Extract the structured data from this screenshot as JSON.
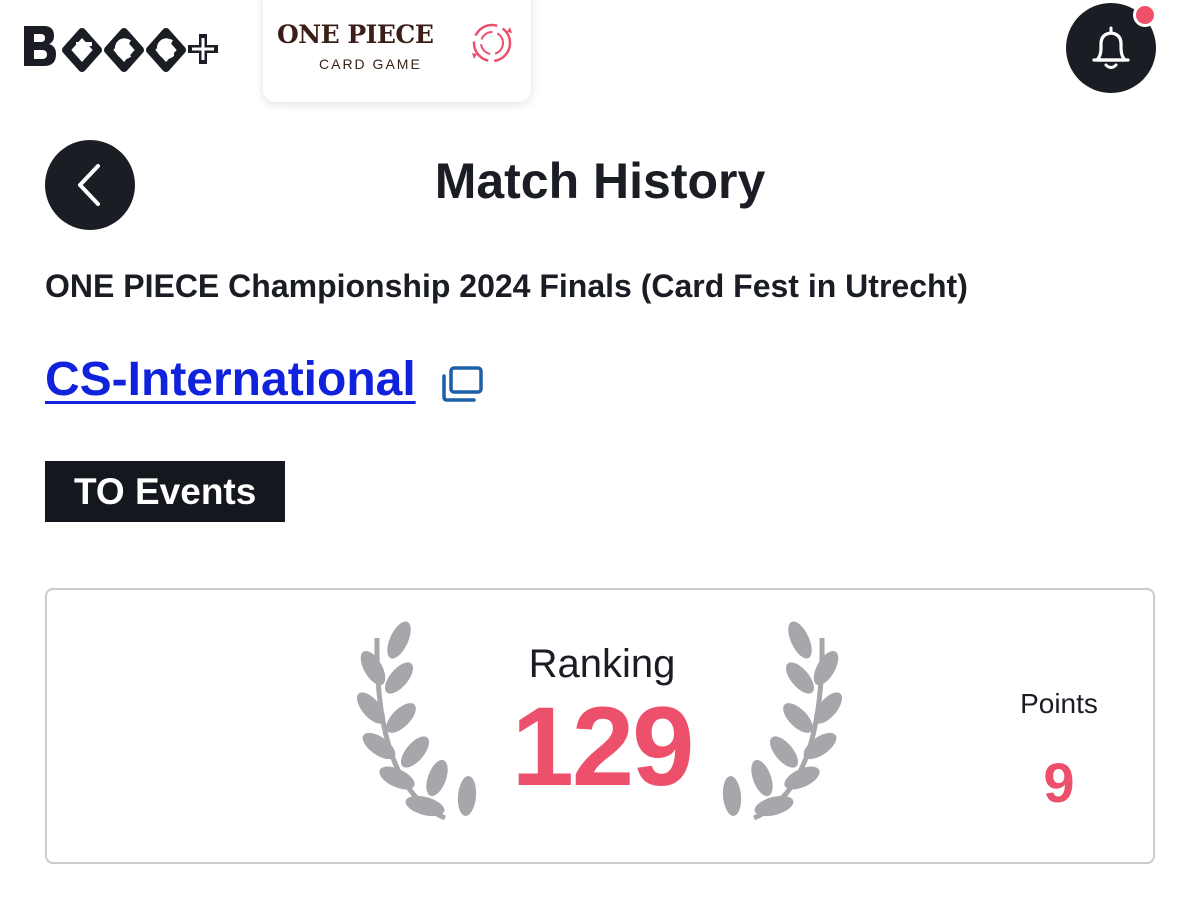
{
  "header": {
    "brand_logo_text": "B TCG +",
    "game_logo": {
      "title": "ONE PIECE",
      "subtitle": "CARD GAME"
    },
    "notification_icon": "bell-icon",
    "notification_badge_color": "#f0506a"
  },
  "page": {
    "back_icon": "chevron-left-icon",
    "title": "Match History",
    "event_name": "ONE PIECE Championship 2024 Finals (Card Fest in Utrecht)",
    "store_name": "CS-International",
    "store_link_icon": "external-window-icon",
    "badge": "TO Events"
  },
  "ranking": {
    "label": "Ranking",
    "value": "129",
    "points_label": "Points",
    "points_value": "9",
    "laurel_icon": "laurel-wreath-icon"
  },
  "colors": {
    "accent": "#ec506b",
    "dark": "#1b1d24",
    "link": "#1122dd"
  }
}
